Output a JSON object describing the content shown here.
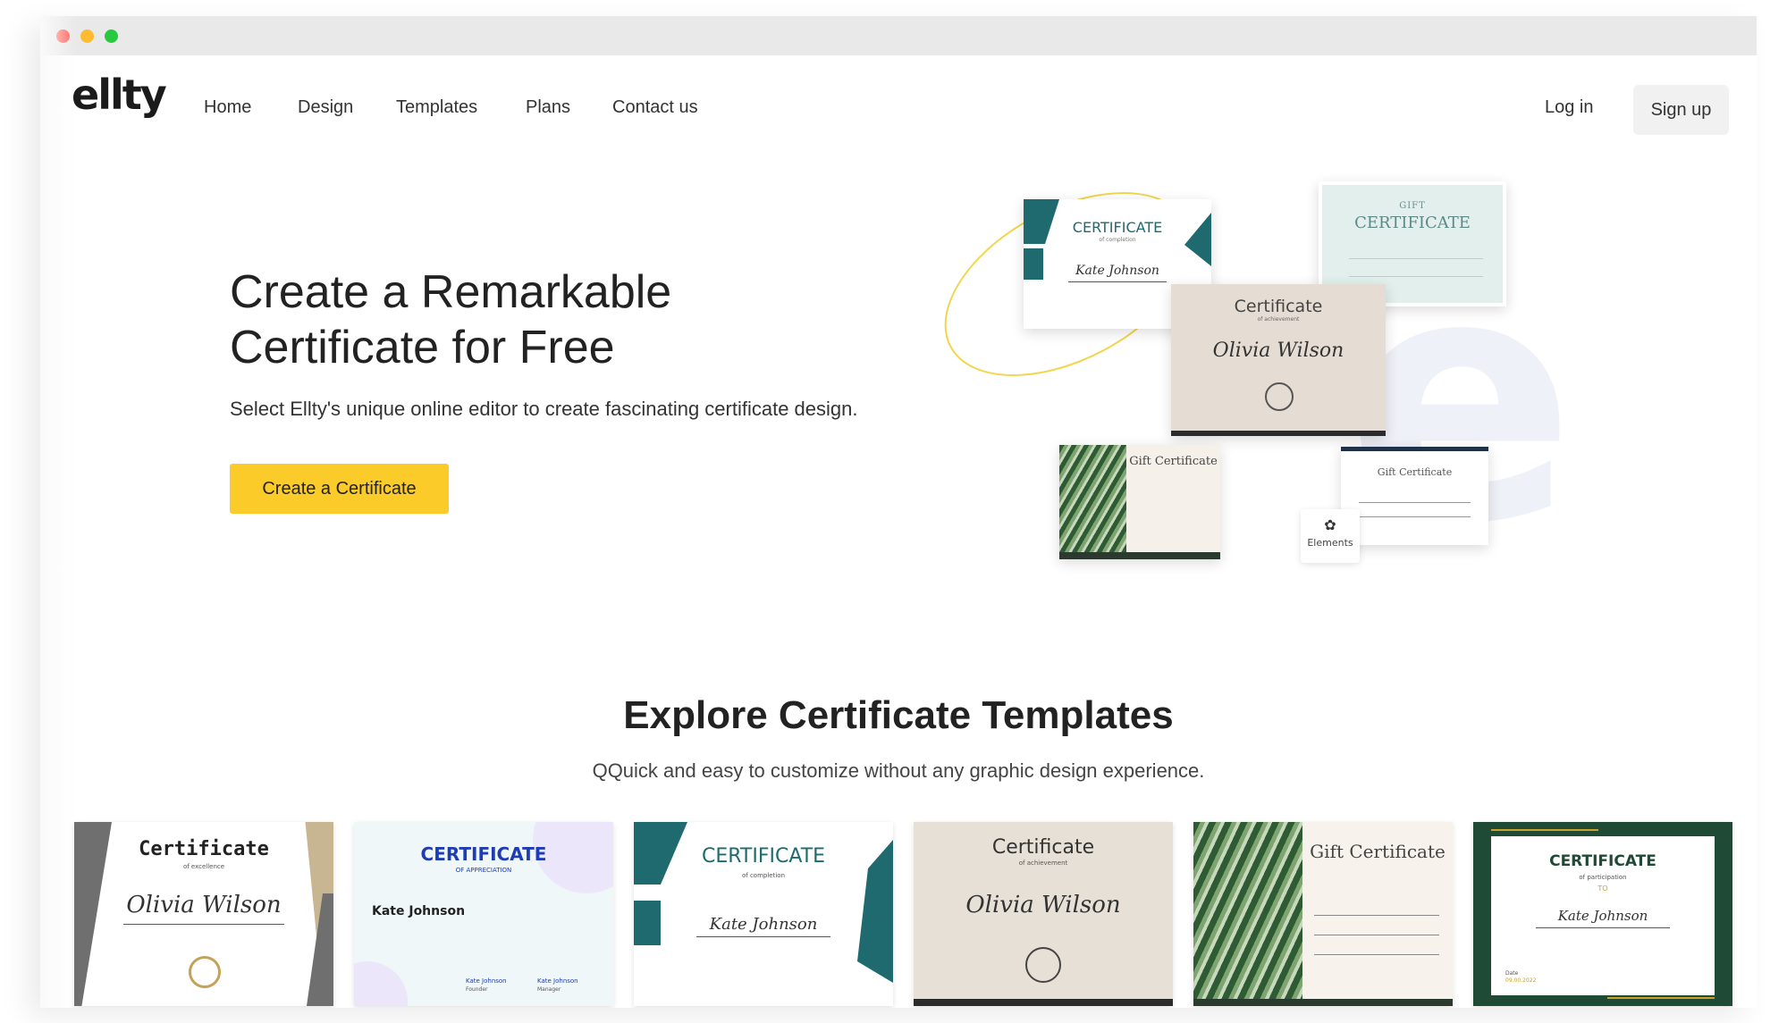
{
  "browser": {
    "window_controls": [
      "close",
      "minimize",
      "zoom"
    ]
  },
  "nav": {
    "logo": "ellty",
    "links": [
      "Home",
      "Design",
      "Templates",
      "Plans",
      "Contact us"
    ],
    "login": "Log in",
    "signup": "Sign up"
  },
  "hero": {
    "title_line1": "Create a Remarkable",
    "title_line2": "Certificate for Free",
    "subtitle": "Select Ellty's unique online editor to create fascinating certificate design.",
    "cta": "Create a Certificate"
  },
  "collage": {
    "card1": {
      "title": "CERTIFICATE",
      "sub": "of completion",
      "name": "Kate Johnson"
    },
    "card2": {
      "title_top": "GIFT",
      "title": "CERTIFICATE"
    },
    "card3": {
      "title": "Certificate",
      "sub": "of achievement",
      "name": "Olivia Wilson"
    },
    "card4": {
      "title": "Gift Certificate"
    },
    "card5": {
      "title": "Gift Certificate"
    },
    "elements_label": "Elements",
    "watermark": "e"
  },
  "templates_section": {
    "title": "Explore Certificate Templates",
    "subtitle": "QQuick and easy to customize without any graphic design experience."
  },
  "templates": [
    {
      "title": "Certificate",
      "sub": "of excellence",
      "name": "Olivia Wilson"
    },
    {
      "title": "CERTIFICATE",
      "sub": "OF APPRECIATION",
      "name": "Kate Johnson",
      "sig1": "Kate Johnson",
      "role1": "Founder",
      "sig2": "Kate Johnson",
      "role2": "Manager"
    },
    {
      "title": "CERTIFICATE",
      "sub": "of completion",
      "name": "Kate Johnson"
    },
    {
      "title": "Certificate",
      "sub": "of achievement",
      "name": "Olivia Wilson"
    },
    {
      "title": "Gift Certificate"
    },
    {
      "title": "CERTIFICATE",
      "sub": "of participation",
      "name": "Kate Johnson",
      "to": "TO",
      "date": "Date",
      "date_value": "09.00.2022"
    }
  ],
  "colors": {
    "accent": "#fbcb2a",
    "teal": "#1e6a6e",
    "green_dark": "#1f4a36",
    "navy": "#1e3db4"
  }
}
